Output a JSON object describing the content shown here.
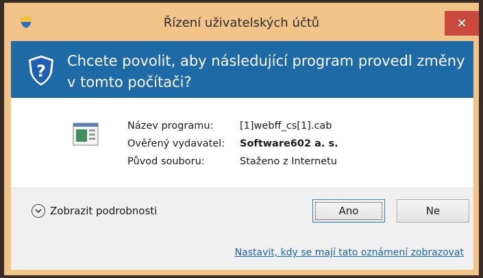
{
  "window": {
    "title": "Řízení uživatelských účtů",
    "close_glyph": "✕"
  },
  "header": {
    "question": "Chcete povolit, aby následující program provedl změny v tomto počítači?",
    "icon": "uac-shield-question-icon"
  },
  "details": {
    "app_icon": "program-icon",
    "rows": [
      {
        "label": "Název programu:",
        "value": "[1]webff_cs[1].cab",
        "bold": false
      },
      {
        "label": "Ověřený vydavatel:",
        "value": "Software602 a. s.",
        "bold": true
      },
      {
        "label": "Původ souboru:",
        "value": "Staženo z Internetu",
        "bold": false
      }
    ]
  },
  "footer": {
    "details_toggle": "Zobrazit podrobnosti",
    "yes_button": "Ano",
    "no_button": "Ne",
    "settings_link": "Nastavit, kdy se mají tato oznámení zobrazovat"
  },
  "colors": {
    "titlebar": "#f2c48a",
    "header": "#1d6aa6",
    "close": "#c94a3d",
    "link": "#1a63b0"
  }
}
